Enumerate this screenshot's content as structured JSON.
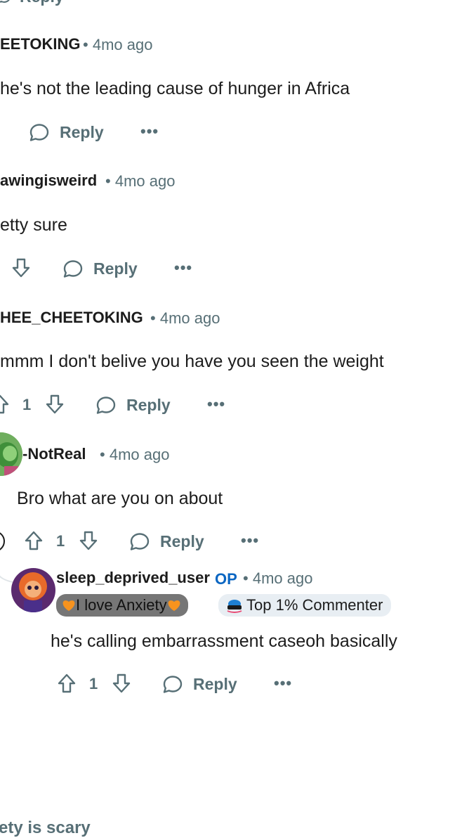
{
  "top_partial": {
    "text": "Reply"
  },
  "comments": [
    {
      "author": "EETOKING",
      "time": "4mo ago",
      "body": "he's not the leading cause of hunger in Africa",
      "reply_label": "Reply",
      "more": "•••"
    },
    {
      "author": "awingisweird",
      "time": "4mo ago",
      "body": "etty sure",
      "reply_label": "Reply",
      "more": "•••"
    },
    {
      "author": "HEE_CHEETOKING",
      "time": "4mo ago",
      "body": "mmm I don't belive you have you seen the weight",
      "vote_count": "1",
      "reply_label": "Reply",
      "more": "•••"
    },
    {
      "author": "-NotReal",
      "time": "4mo ago",
      "body": "Bro what are you on about",
      "vote_count": "1",
      "reply_label": "Reply",
      "more": "•••"
    },
    {
      "author": "sleep_deprived_user",
      "op_badge": "OP",
      "time": "4mo ago",
      "flair_user": "I love Anxiety",
      "flair_commenter": "Top 1% Commenter",
      "body": "he's calling embarrassment caseoh basically",
      "vote_count": "1",
      "reply_label": "Reply",
      "more": "•••"
    }
  ],
  "bottom_partial": {
    "text": "ety is scary"
  },
  "colors": {
    "meta": "#576f76",
    "op": "#0a66c2",
    "flair_dark": "#767676",
    "flair_light": "#e8eef3",
    "heart": "#f7931e"
  }
}
